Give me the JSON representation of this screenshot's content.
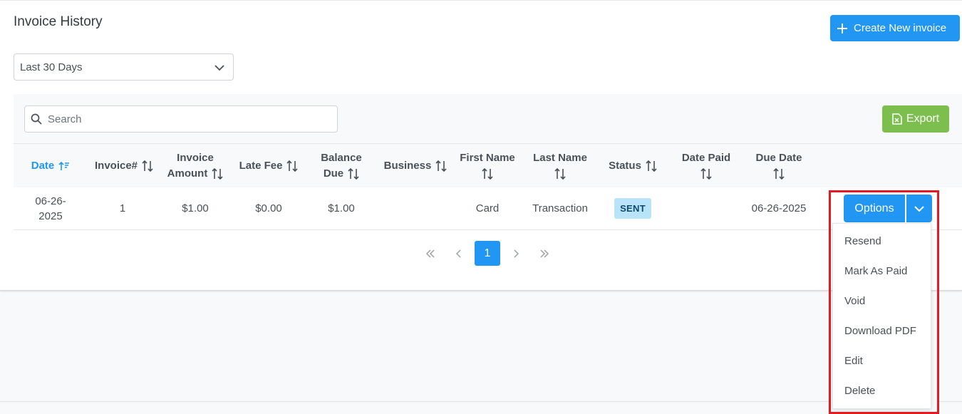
{
  "header": {
    "title": "Invoice History",
    "create_button": "Create New invoice"
  },
  "filters": {
    "date_range": "Last 30 Days",
    "search_placeholder": "Search",
    "export_label": "Export"
  },
  "table": {
    "columns": [
      {
        "line1": "Date",
        "line2": ""
      },
      {
        "line1": "Invoice#",
        "line2": ""
      },
      {
        "line1": "Invoice",
        "line2": "Amount"
      },
      {
        "line1": "Late Fee",
        "line2": ""
      },
      {
        "line1": "Balance",
        "line2": "Due"
      },
      {
        "line1": "Business",
        "line2": ""
      },
      {
        "line1": "First Name",
        "line2": ""
      },
      {
        "line1": "Last Name",
        "line2": ""
      },
      {
        "line1": "Status",
        "line2": ""
      },
      {
        "line1": "Date Paid",
        "line2": ""
      },
      {
        "line1": "Due Date",
        "line2": ""
      }
    ],
    "rows": [
      {
        "date_line1": "06-26-",
        "date_line2": "2025",
        "invoice_no": "1",
        "invoice_amount": "$1.00",
        "late_fee": "$0.00",
        "balance_due": "$1.00",
        "business": "",
        "first_name": "Card",
        "last_name": "Transaction",
        "status": "SENT",
        "date_paid": "",
        "due_date": "06-26-2025"
      }
    ]
  },
  "row_actions": {
    "options_label": "Options",
    "menu": [
      "Resend",
      "Mark As Paid",
      "Void",
      "Download PDF",
      "Edit",
      "Delete"
    ]
  },
  "pagination": {
    "current_page": "1"
  },
  "colors": {
    "primary": "#2196f3",
    "export": "#7cbf4f",
    "highlight": "#e31b23",
    "status_badge_bg": "#b9e3f8"
  }
}
